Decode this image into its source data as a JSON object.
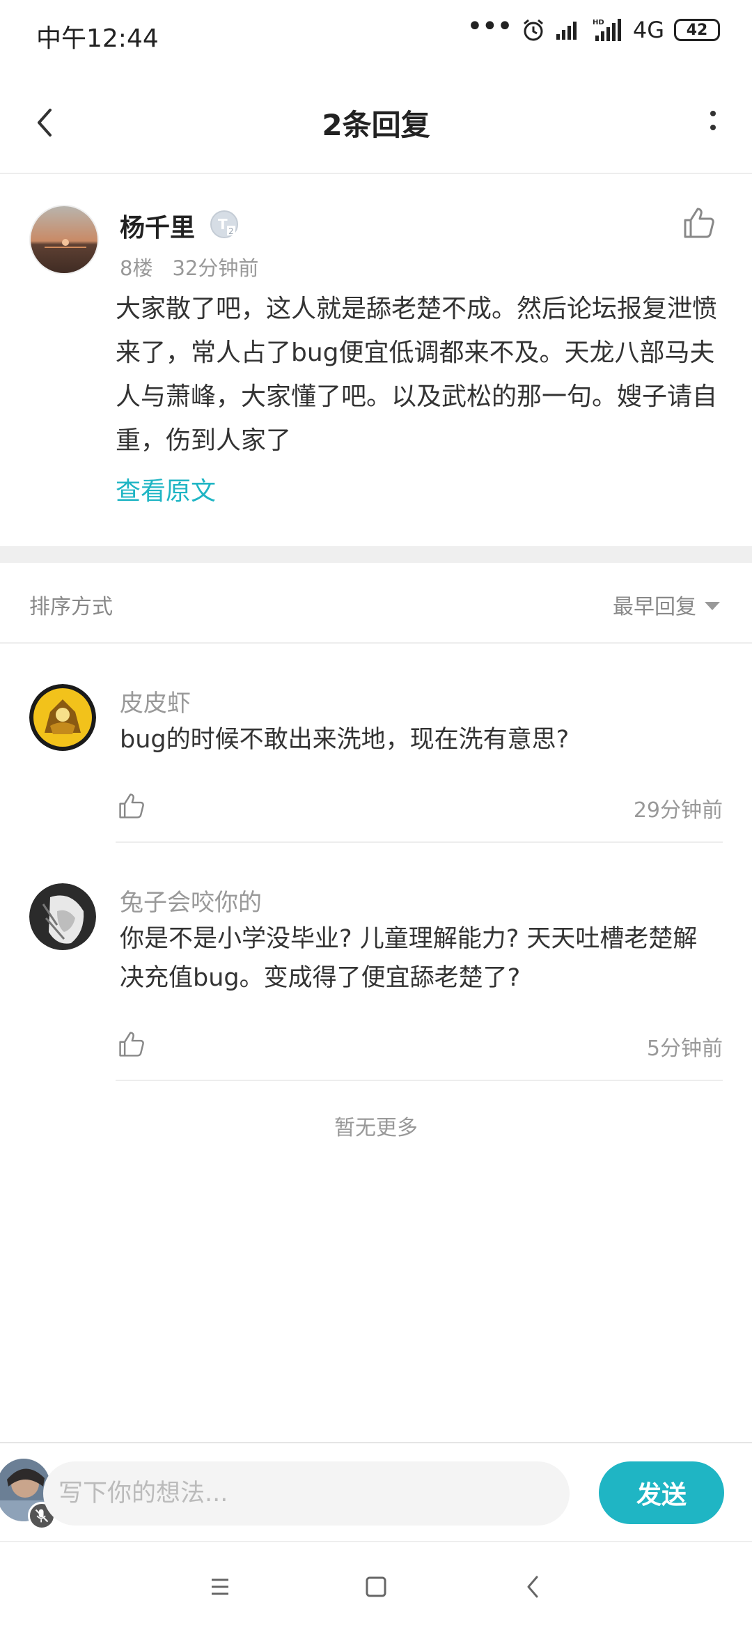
{
  "status_bar": {
    "time": "中午12:44",
    "network": "4G",
    "battery": "42"
  },
  "header": {
    "title": "2条回复"
  },
  "post": {
    "author": "杨千里",
    "floor": "8楼",
    "time": "32分钟前",
    "content": "大家散了吧，这人就是舔老楚不成。然后论坛报复泄愤来了，常人占了bug便宜低调都来不及。天龙八部马夫人与萧峰，大家懂了吧。以及武松的那一句。嫂子请自重，伤到人家了",
    "view_original": "查看原文"
  },
  "sort": {
    "label": "排序方式",
    "selected": "最早回复"
  },
  "replies": [
    {
      "author": "皮皮虾",
      "text": "bug的时候不敢出来洗地，现在洗有意思?",
      "time": "29分钟前"
    },
    {
      "author": "兔子会咬你的",
      "text": "你是不是小学没毕业? 儿童理解能力? 天天吐槽老楚解决充值bug。变成得了便宜舔老楚了?",
      "time": "5分钟前"
    }
  ],
  "no_more": "暂无更多",
  "input_bar": {
    "placeholder": "写下你的想法...",
    "send_label": "发送"
  },
  "colors": {
    "accent": "#1fb5c4"
  }
}
